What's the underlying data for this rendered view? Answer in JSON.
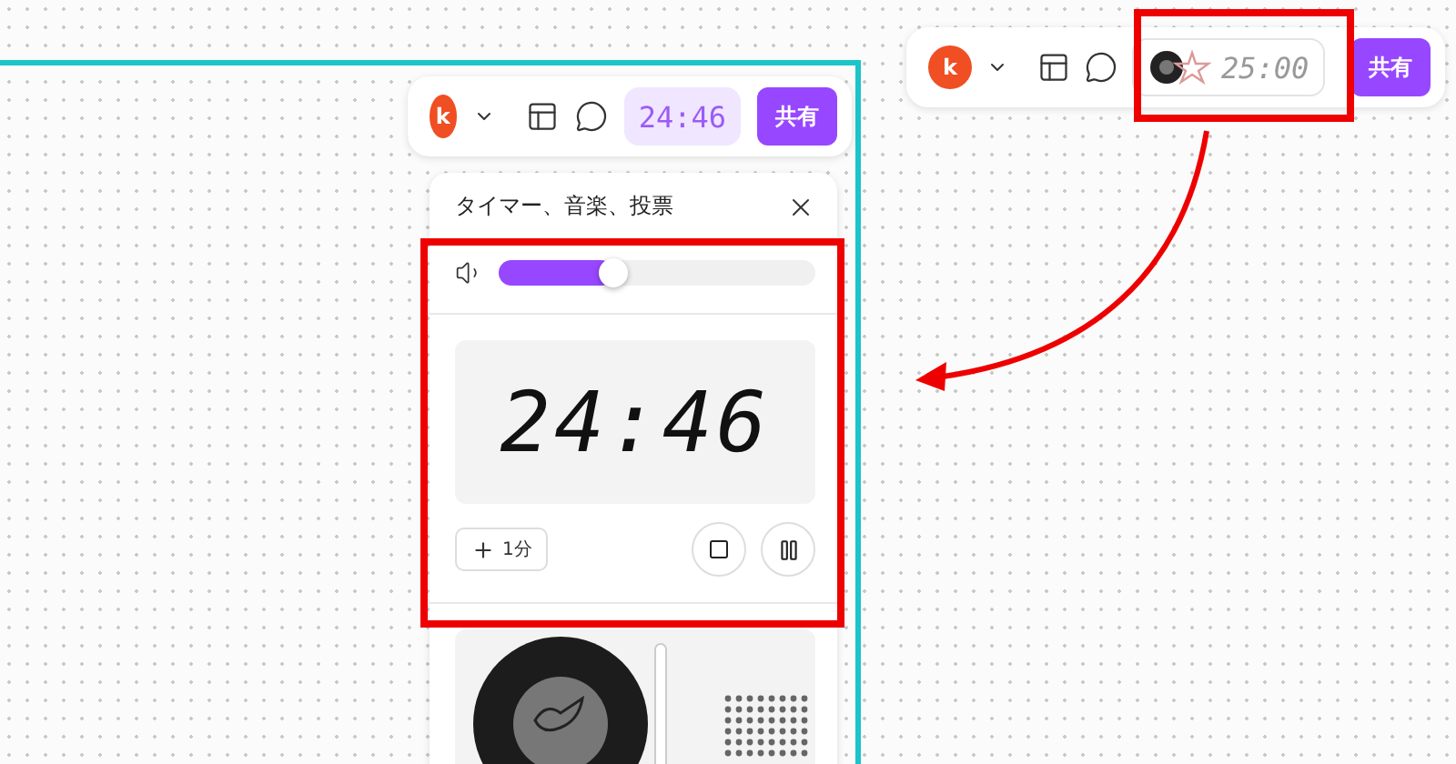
{
  "top_toolbar": {
    "avatar": "k",
    "timer": "25:00",
    "share": "共有"
  },
  "frame": {
    "toolbar": {
      "avatar": "k",
      "timer": "24:46",
      "share": "共有"
    },
    "panel": {
      "title": "タイマー、音楽、投票",
      "volume": {
        "level": 0.36
      },
      "timer_display": "24:46",
      "add_button": "1分"
    }
  }
}
